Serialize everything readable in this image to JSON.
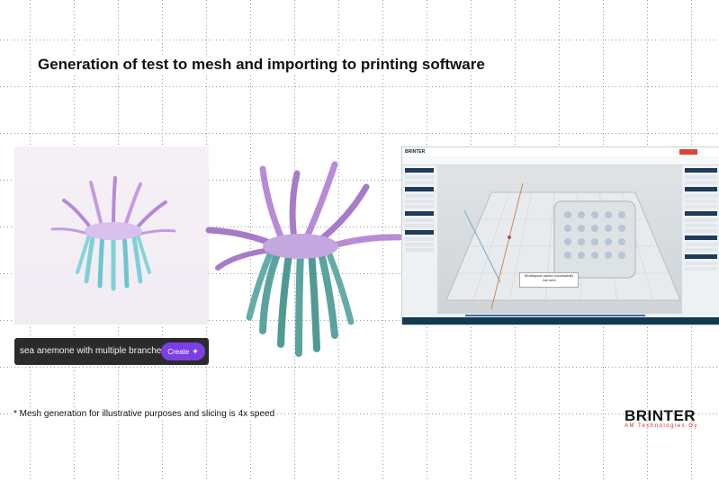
{
  "slide": {
    "title": "Generation of test to mesh and importing to printing software",
    "footnote": "* Mesh generation for illustrative purposes and slicing is 4x speed"
  },
  "generator": {
    "prompt_value": "sea anemone with multiple branches",
    "create_label": "Create",
    "create_icon": "sparkle-icon"
  },
  "slicer": {
    "brand": "BRINTER",
    "dialog_line1": "Workspace saved successfully",
    "dialog_line2": "Job sent"
  },
  "logo": {
    "name": "BRINTER",
    "tagline": "AM Technologies Oy"
  },
  "colors": {
    "accent": "#7b3fe4",
    "logo_red": "#d42a2a",
    "slicer_dark": "#123a52"
  }
}
